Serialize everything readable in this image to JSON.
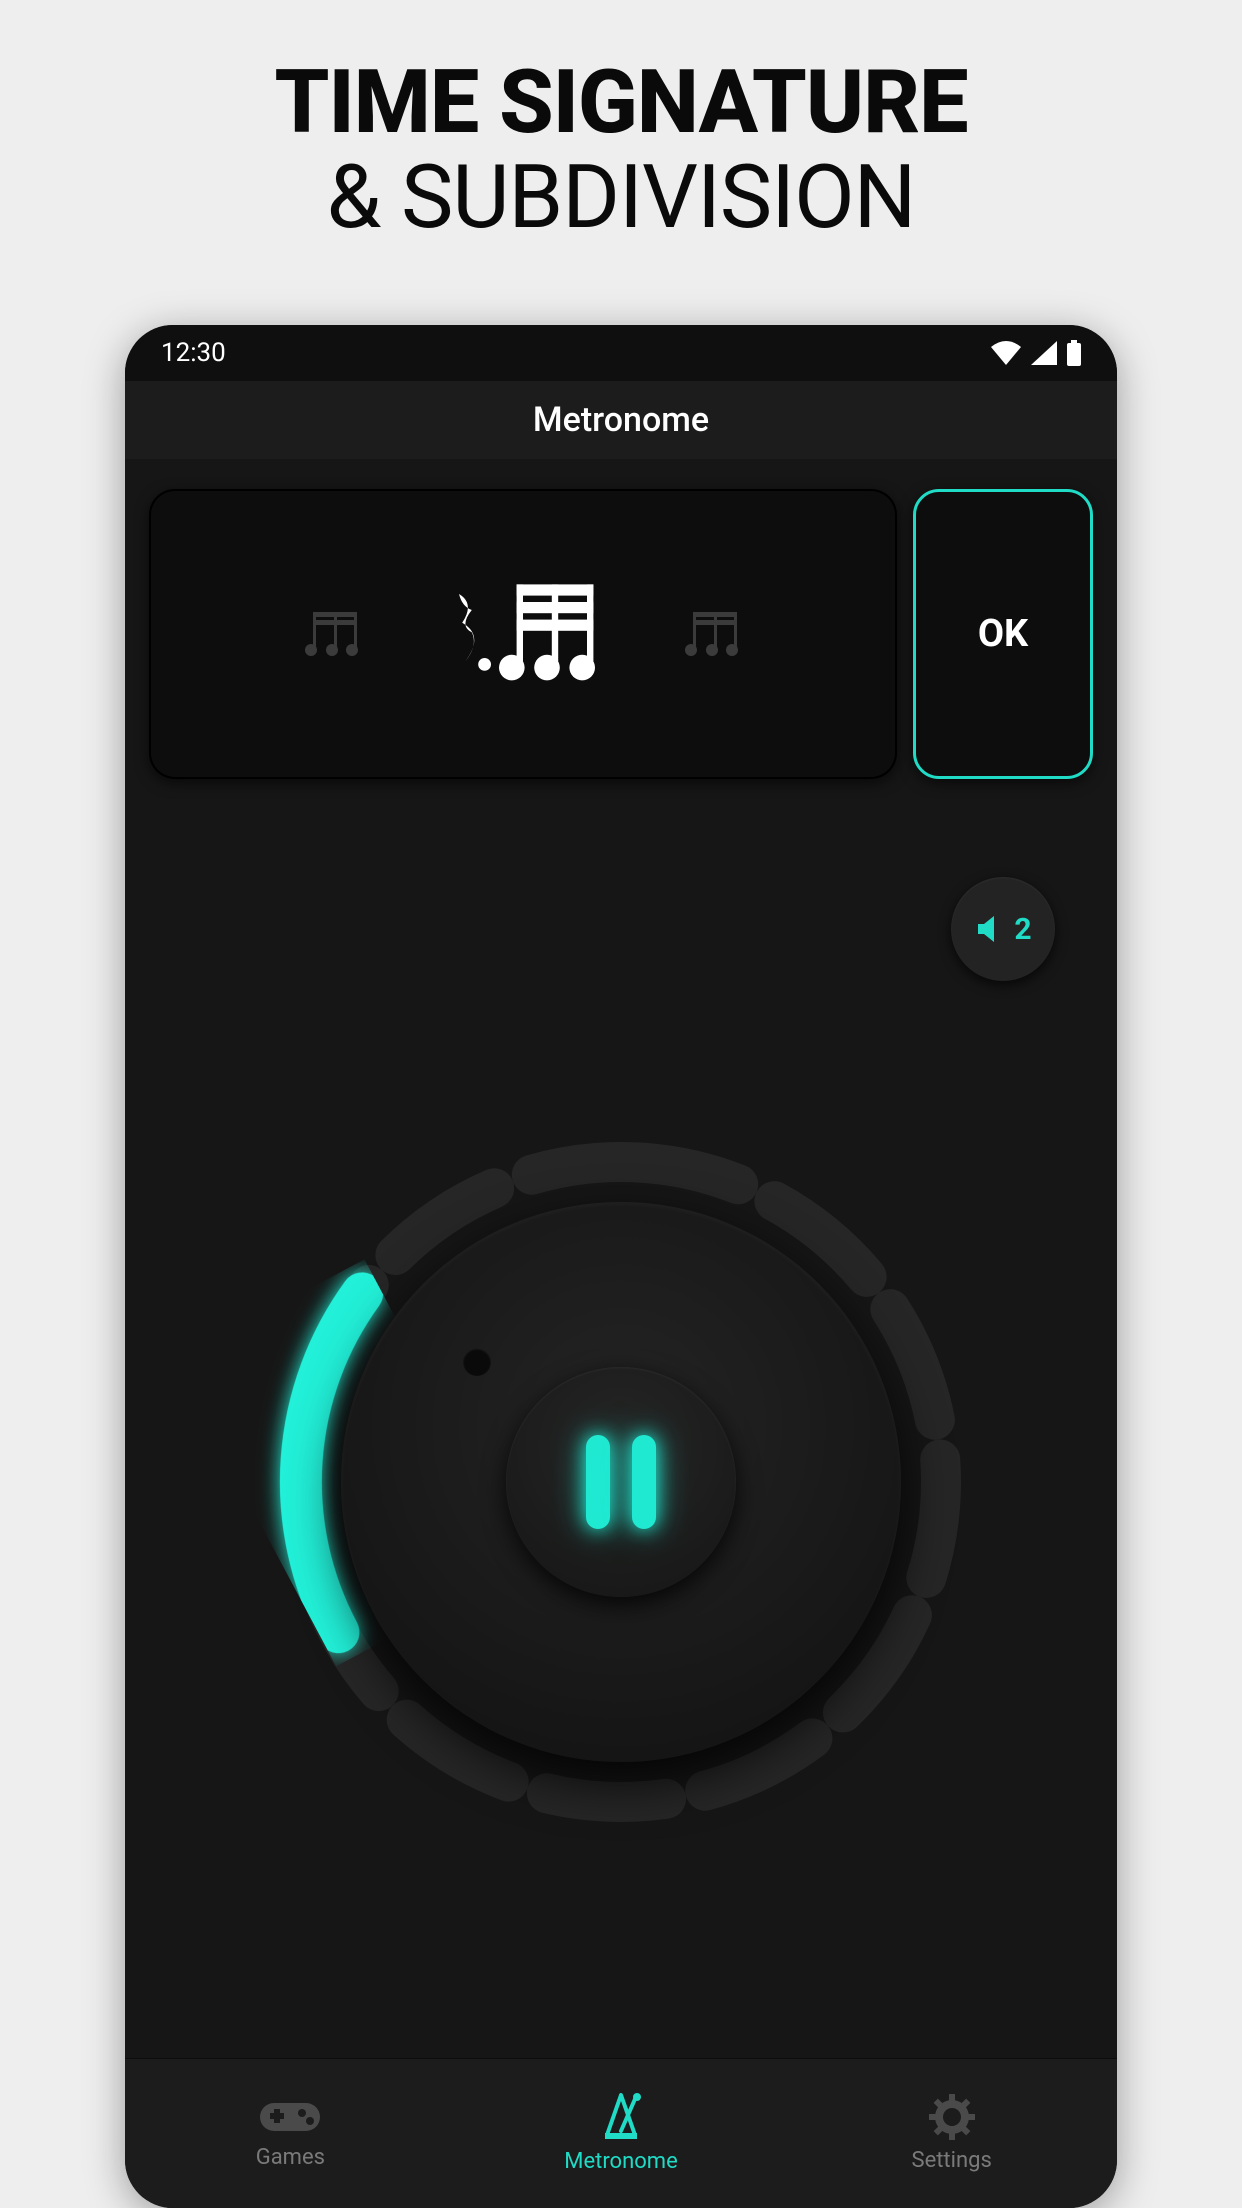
{
  "promo": {
    "line1": "TIME SIGNATURE",
    "line2": "& SUBDIVISION"
  },
  "statusbar": {
    "time": "12:30"
  },
  "appbar": {
    "title": "Metronome"
  },
  "selector": {
    "ok_label": "OK"
  },
  "volume": {
    "level": "2"
  },
  "colors": {
    "accent": "#20dbc5"
  },
  "nav": {
    "items": [
      {
        "label": "Games",
        "active": false
      },
      {
        "label": "Metronome",
        "active": true
      },
      {
        "label": "Settings",
        "active": false
      }
    ]
  }
}
